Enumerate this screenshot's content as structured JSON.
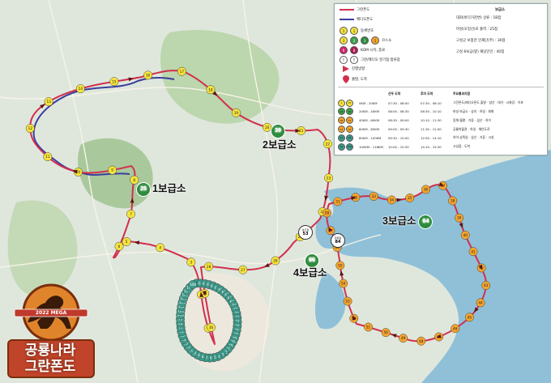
{
  "colors": {
    "route_granfondo": "#d32f4d",
    "route_mediofondo": "#3a3f9e",
    "rest_stop": "#2e8b3e",
    "cp_yellow": "#f5e33c",
    "cp_pink": "#d6206c",
    "cp_green": "#3aa04a",
    "cp_orange": "#f3a42c",
    "cp_teal": "#3b9b8a"
  },
  "legend": {
    "route_granfondo": "그란폰도",
    "route_mediofondo": "메디오폰도",
    "icon_row_1": {
      "samples": [
        "1",
        "1"
      ],
      "label": "동체번호"
    },
    "icon_row_2": {
      "samples": [
        "3",
        "2",
        "3",
        "1"
      ],
      "label": "코스소"
    },
    "icon_row_3": {
      "samples": [
        "R",
        "B"
      ],
      "label": "KOM 시작, 종료"
    },
    "icon_row_4": {
      "samples": [
        "T",
        "T"
      ],
      "label": "그란/메디오 분기점·합류점"
    },
    "direction": "진행방향",
    "start_finish": "출발, 도착",
    "rest_title": "보급소",
    "rest_stops": [
      "대회(바다거천변) 상류 : 1B점",
      "마성(오일선)로 출력 : 25점",
      "고성군 보험관 인재단(주) : 30점",
      "고성 6보급(앞) 재당인인 : 40점"
    ],
    "table_headers": [
      "",
      "선두 도착",
      "후미 도착",
      "주요통과지점"
    ],
    "table_rows": [
      {
        "cp": [
          "1",
          "25"
        ],
        "dist": "0KM - 20KM",
        "lead": "07:30 - 08:00",
        "tail": "07:30 - 08:10",
        "via": "그란폰도/메디오폰도 출발 · 방산 · 대가 · 시화강 · 이포"
      },
      {
        "cp": [
          "25",
          "39"
        ],
        "dist": "20KM - 40KM",
        "lead": "08:00 - 08:30",
        "tail": "08:30 - 10:10",
        "via": "마성·보급소 · 상리 · 하일 · 회화"
      },
      {
        "cp": [
          "39",
          "57"
        ],
        "dist": "40KM - 60KM",
        "lead": "08:30 - 09:00",
        "tail": "10:10 - 11:30",
        "via": "동해·월평 · 거류 · 삼산 · 하이"
      },
      {
        "cp": [
          "57",
          "70"
        ],
        "dist": "60KM - 80KM",
        "lead": "09:00 - 09:30",
        "tail": "11:30 - 12:50",
        "via": "공룡박물관 · 하일 · 해안도로"
      },
      {
        "cp": [
          "70",
          "84"
        ],
        "dist": "80KM - 100KM",
        "lead": "09:30 - 10:00",
        "tail": "12:50 - 14:10",
        "via": "하이·상족암 · 삼산 · 거류 · 고성"
      },
      {
        "cp": [
          "84",
          "108"
        ],
        "dist": "100KM - 118KM",
        "lead": "10:00 - 10:30",
        "tail": "14:10 - 15:30",
        "via": "고성읍 · 도착"
      }
    ]
  },
  "stations": [
    {
      "name": "1보급소",
      "number": "25"
    },
    {
      "name": "2보급소",
      "number": "39"
    },
    {
      "name": "3보급소",
      "number": "64"
    },
    {
      "name": "4보급소",
      "number": "86"
    }
  ],
  "junctions": [
    {
      "code": "분기점",
      "number": "53"
    },
    {
      "code": "합류점",
      "number": "84"
    }
  ],
  "logo": {
    "line1": "공룡나라",
    "line2": "그란폰도",
    "banner": "2022 MEGA"
  },
  "map_labels": {
    "checkpoints_red": [
      "1",
      "2",
      "3",
      "4",
      "5",
      "6",
      "7",
      "8",
      "9",
      "10",
      "11",
      "12",
      "13",
      "14",
      "15",
      "16",
      "17",
      "18",
      "19",
      "20",
      "21",
      "22",
      "23",
      "24",
      "25",
      "26",
      "27",
      "28",
      "29",
      "30",
      "31",
      "32",
      "33",
      "34",
      "35",
      "36",
      "37",
      "38",
      "39",
      "40",
      "41",
      "42",
      "43",
      "44",
      "45",
      "46",
      "47",
      "48",
      "49",
      "50",
      "51",
      "52",
      "53",
      "54",
      "55",
      "56",
      "57",
      "58",
      "59",
      "60",
      "61",
      "62",
      "63",
      "64",
      "65",
      "66",
      "67",
      "68",
      "69",
      "70",
      "71",
      "72",
      "73",
      "74",
      "75",
      "76",
      "77",
      "78",
      "79",
      "80",
      "81",
      "82",
      "83",
      "84",
      "85",
      "86",
      "87",
      "88",
      "89",
      "90",
      "91",
      "92",
      "93",
      "94",
      "95",
      "96",
      "97",
      "98",
      "99",
      "100",
      "101",
      "102",
      "103",
      "104",
      "105",
      "106",
      "107",
      "108"
    ]
  }
}
